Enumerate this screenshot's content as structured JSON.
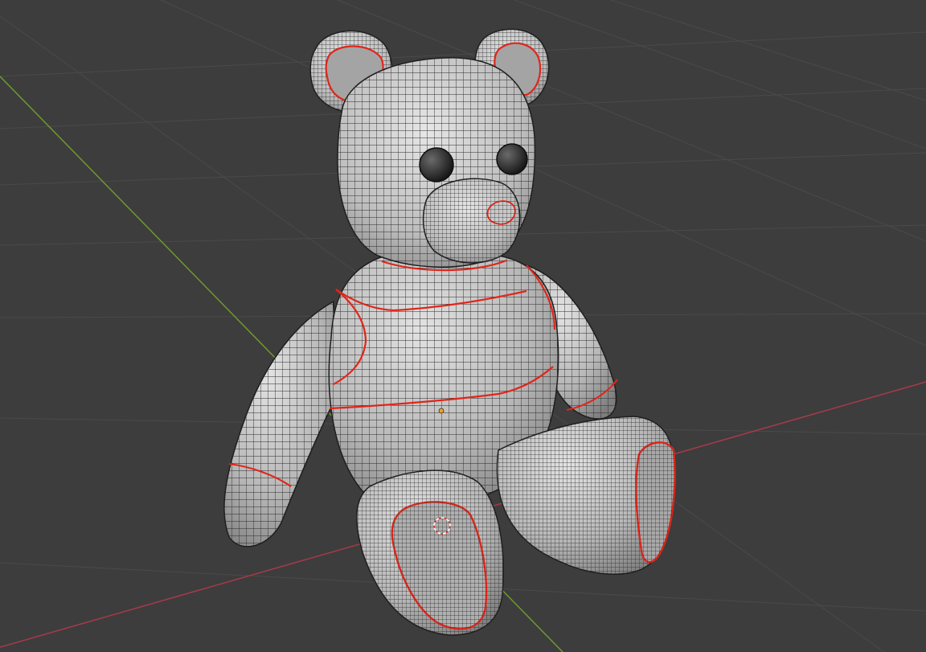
{
  "viewport": {
    "background_color": "#3d3d3d",
    "grid_color": "#4a4a4a",
    "x_axis_color": "#a63a4a",
    "y_axis_color": "#6e9a2e",
    "seam_color": "#e0261a",
    "mesh_fill_color": "#b7b7b7",
    "mesh_wire_color": "#2a2a2a"
  },
  "scene": {
    "object": "teddy-bear-mesh",
    "display_mode": "wireframe-overlay",
    "origin_marker_color": "#f0a030",
    "cursor_marker": "3d-cursor"
  }
}
